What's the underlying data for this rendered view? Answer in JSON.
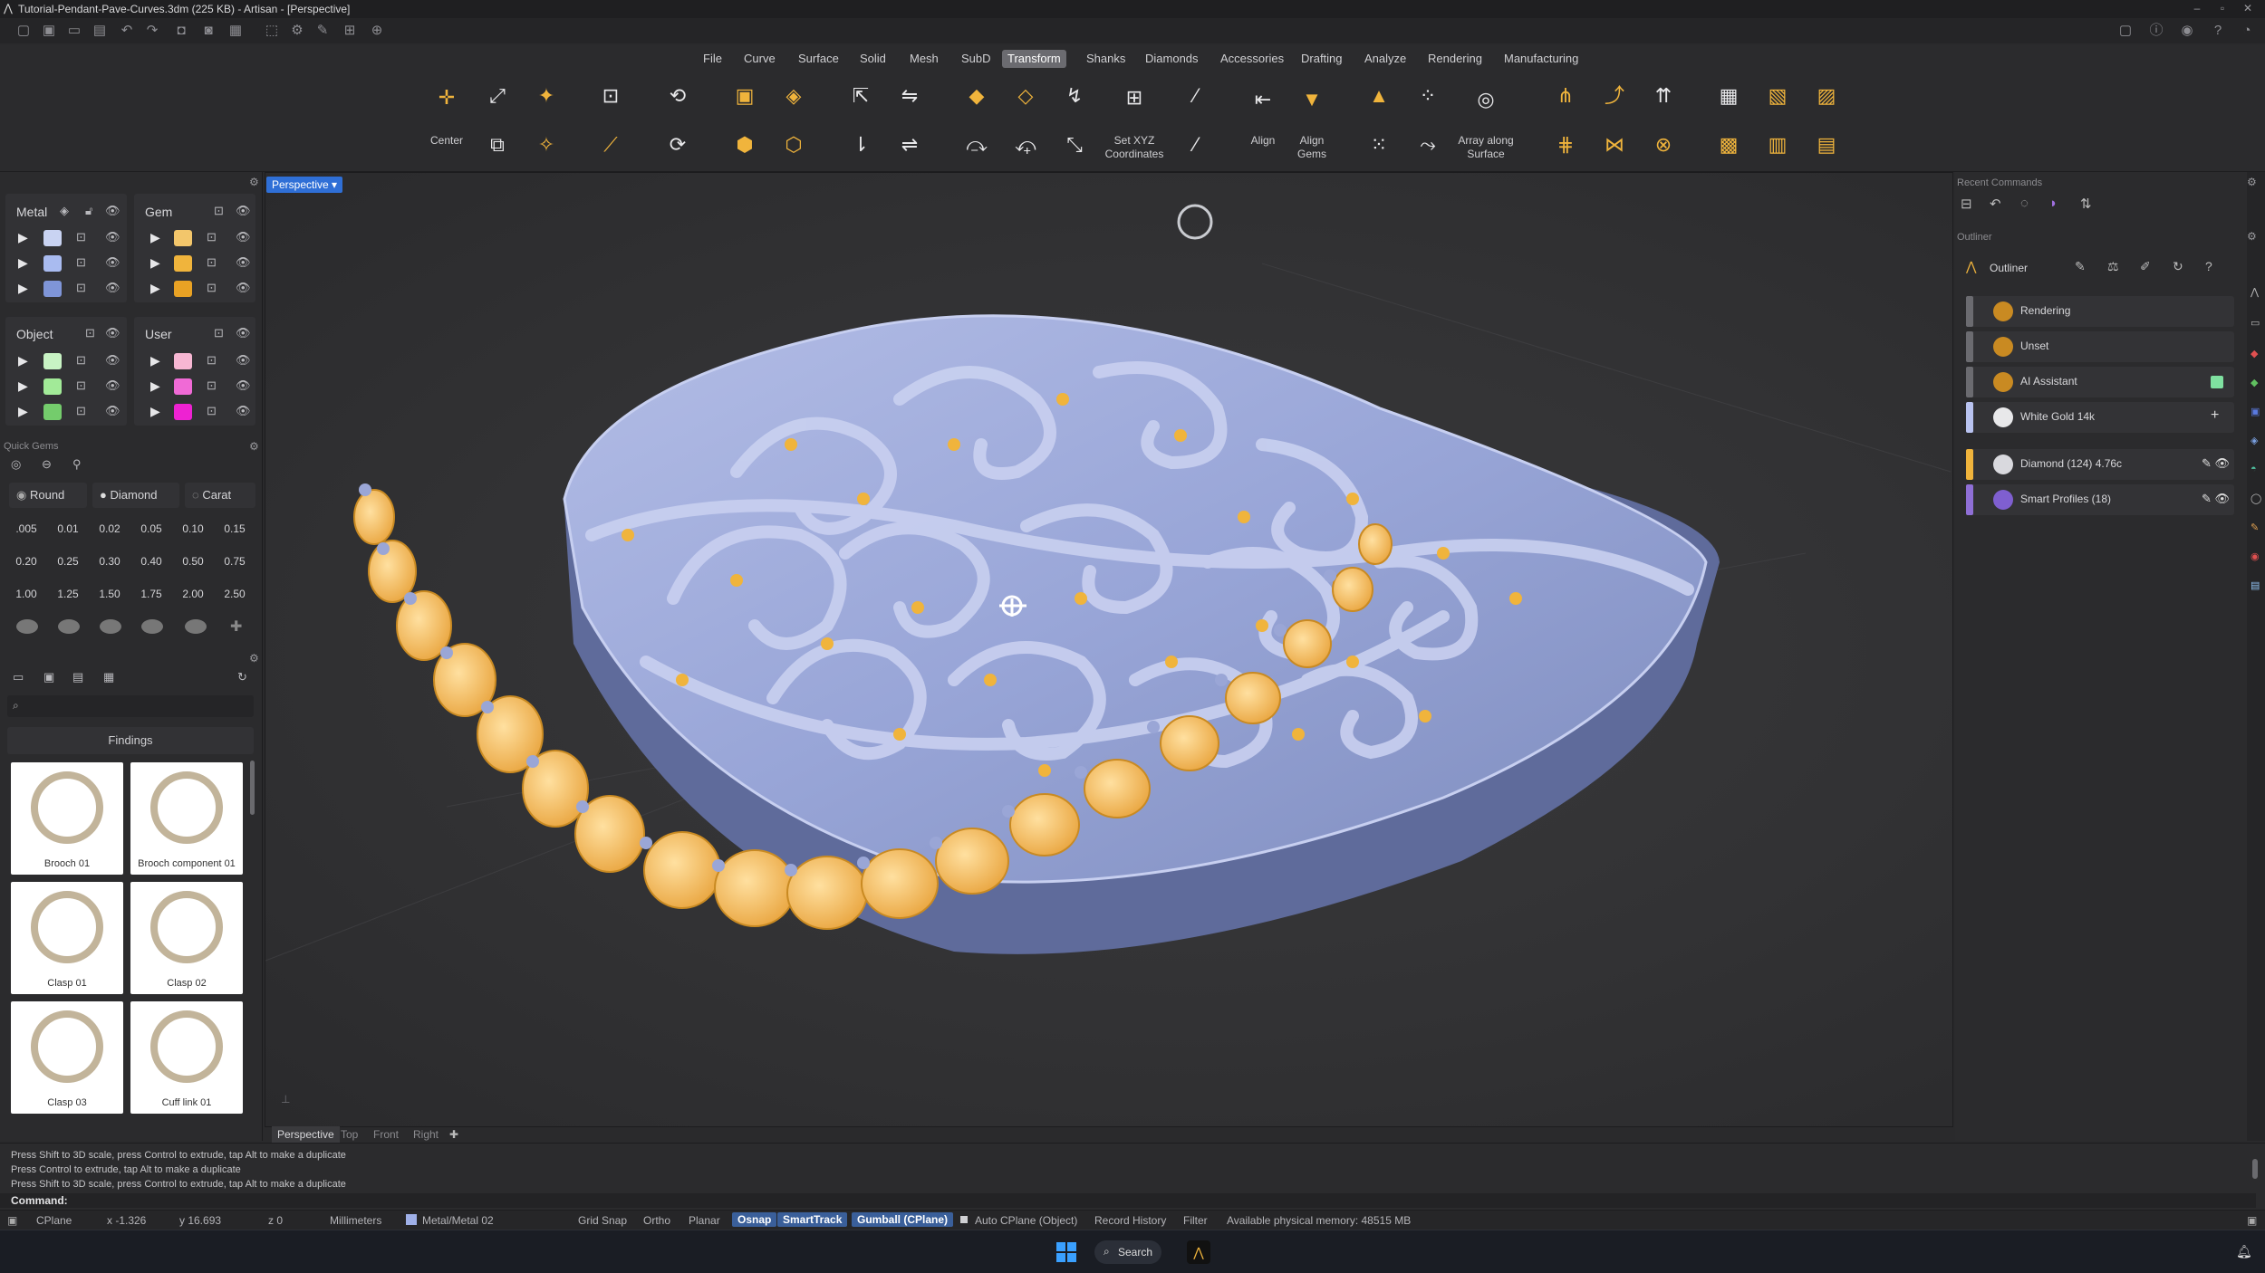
{
  "window": {
    "title": "Tutorial-Pendant-Pave-Curves.3dm (225 KB) - Artisan - [Perspective]"
  },
  "menu": {
    "items": [
      "File",
      "Curve",
      "Surface",
      "Solid",
      "Mesh",
      "SubD",
      "Transform",
      "Shanks",
      "Diamonds",
      "Accessories",
      "Drafting",
      "Analyze",
      "Rendering",
      "Manufacturing"
    ],
    "active": "Transform"
  },
  "ribbon": {
    "center_label": "Center",
    "set_xyz_label_1": "Set XYZ",
    "set_xyz_label_2": "Coordinates",
    "align_label": "Align",
    "align_gems_label_1": "Align",
    "align_gems_label_2": "Gems",
    "array_label_1": "Array along",
    "array_label_2": "Surface"
  },
  "layers": {
    "metal": "Metal",
    "gem": "Gem",
    "object": "Object",
    "user": "User",
    "metal_colors": [
      "#c9d3f2",
      "#a9bbf0",
      "#7f95d8"
    ],
    "gem_colors": [
      "#f3c66b",
      "#f0b43c",
      "#e9a224"
    ],
    "object_colors": [
      "#c8f3c4",
      "#a2ea98",
      "#74cc6c"
    ],
    "user_colors": [
      "#f7b7d3",
      "#f06ad6",
      "#ee22d2"
    ]
  },
  "quick_gems": {
    "title": "Quick Gems",
    "shape": "Round",
    "cut": "Diamond",
    "unit": "Carat",
    "sizes": [
      ".005",
      "0.01",
      "0.02",
      "0.05",
      "0.10",
      "0.15",
      "0.20",
      "0.25",
      "0.30",
      "0.40",
      "0.50",
      "0.75",
      "1.00",
      "1.25",
      "1.50",
      "1.75",
      "2.00",
      "2.50"
    ]
  },
  "library": {
    "category": "Findings",
    "items": [
      "Brooch 01",
      "Brooch component 01",
      "Clasp 01",
      "Clasp 02",
      "Clasp 03",
      "Cuff link 01"
    ]
  },
  "viewport": {
    "active": "Perspective",
    "tabs": [
      "Perspective",
      "Top",
      "Front",
      "Right"
    ]
  },
  "right": {
    "recent_title": "Recent Commands",
    "outliner_section": "Outliner",
    "outliner_title": "Outliner",
    "rows": [
      {
        "label": "Rendering",
        "color": "#6b6b70"
      },
      {
        "label": "Unset",
        "color": "#6b6b70"
      },
      {
        "label": "AI Assistant",
        "color": "#6b6b70"
      },
      {
        "label": "White Gold 14k",
        "color": "#b9c3f0"
      },
      {
        "label": "Diamond (124) 4.76c",
        "color": "#f0b43c"
      },
      {
        "label": "Smart Profiles (18)",
        "color": "#8f6fd6"
      }
    ]
  },
  "command": {
    "history": [
      "Press Shift to 3D scale, press Control to extrude, tap Alt to make a duplicate",
      "Press Control to extrude, tap Alt to make a duplicate",
      "Press Shift to 3D scale, press Control to extrude, tap Alt to make a duplicate"
    ],
    "prompt": "Command:"
  },
  "status": {
    "cplane": "CPlane",
    "x": "x -1.326",
    "y": "y 16.693",
    "z": "z 0",
    "units": "Millimeters",
    "layer": "Metal/Metal 02",
    "grid_snap": "Grid Snap",
    "ortho": "Ortho",
    "planar": "Planar",
    "osnap": "Osnap",
    "smarttrack": "SmartTrack",
    "gumball": "Gumball (CPlane)",
    "auto_cplane": "Auto CPlane (Object)",
    "record_history": "Record History",
    "filter": "Filter",
    "memory": "Available physical memory: 48515 MB"
  },
  "taskbar": {
    "search": "Search"
  }
}
